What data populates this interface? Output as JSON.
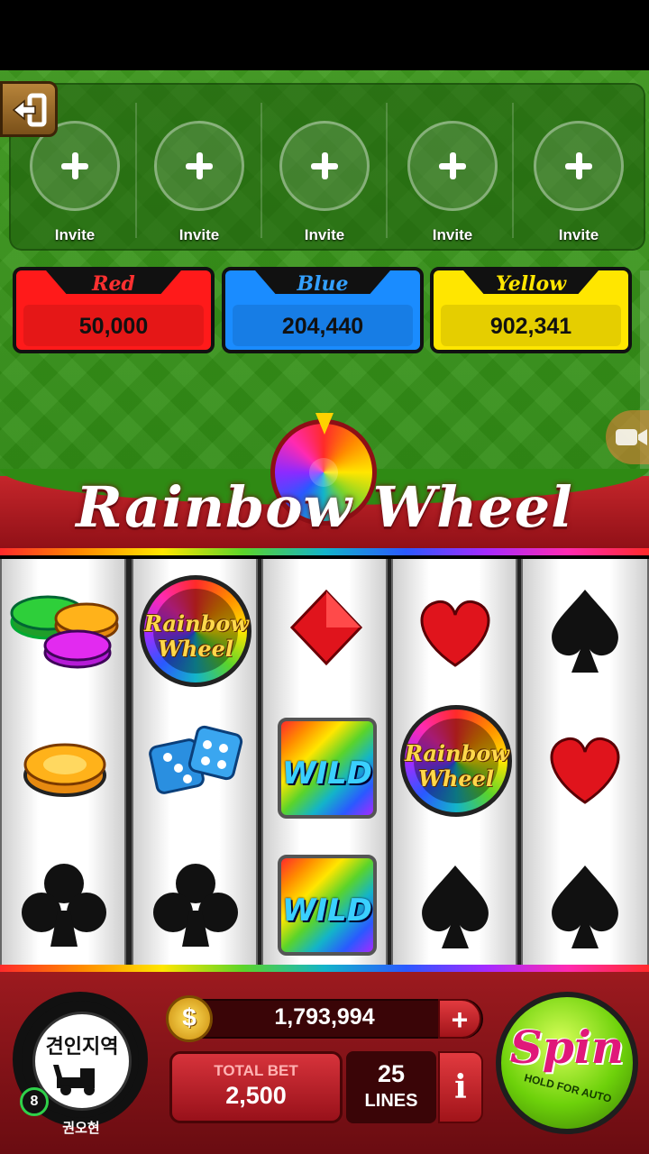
{
  "invite_slots": [
    {
      "label": "Invite"
    },
    {
      "label": "Invite"
    },
    {
      "label": "Invite"
    },
    {
      "label": "Invite"
    },
    {
      "label": "Invite"
    }
  ],
  "teams": [
    {
      "name": "Red",
      "score": "50,000",
      "color": "#ff1a1a"
    },
    {
      "name": "Blue",
      "score": "204,440",
      "color": "#1a8cff"
    },
    {
      "name": "Yellow",
      "score": "902,341",
      "color": "#ffe600"
    }
  ],
  "game_title": "Rainbow Wheel",
  "reels": [
    [
      "chip-stack-icon",
      "chip-stack-small-icon",
      "club-icon"
    ],
    [
      "rainbow-wheel-badge",
      "dice-icon",
      "club-icon"
    ],
    [
      "diamond-icon",
      "wild-icon",
      "wild-icon"
    ],
    [
      "heart-icon",
      "rainbow-wheel-badge",
      "spade-icon"
    ],
    [
      "spade-icon",
      "heart-icon",
      "spade-icon"
    ]
  ],
  "symbol_text": {
    "wild": "WILD",
    "badge_line1": "Rainbow",
    "badge_line2": "Wheel"
  },
  "player": {
    "avatar_text": "견인지역",
    "name": "권오현",
    "level": "8"
  },
  "balance": {
    "currency_icon": "dollar-coin-icon",
    "amount": "1,793,994",
    "add_label": "+"
  },
  "bet": {
    "label": "TOTAL BET",
    "amount": "2,500",
    "lines": "25",
    "lines_label": "LINES",
    "info_label": "i"
  },
  "spin": {
    "label": "Spin",
    "sub_label": "HOLD FOR AUTO"
  },
  "colors": {
    "felt": "#2f8a14",
    "banner": "#b31d23",
    "spin_green": "#6dd10a"
  }
}
